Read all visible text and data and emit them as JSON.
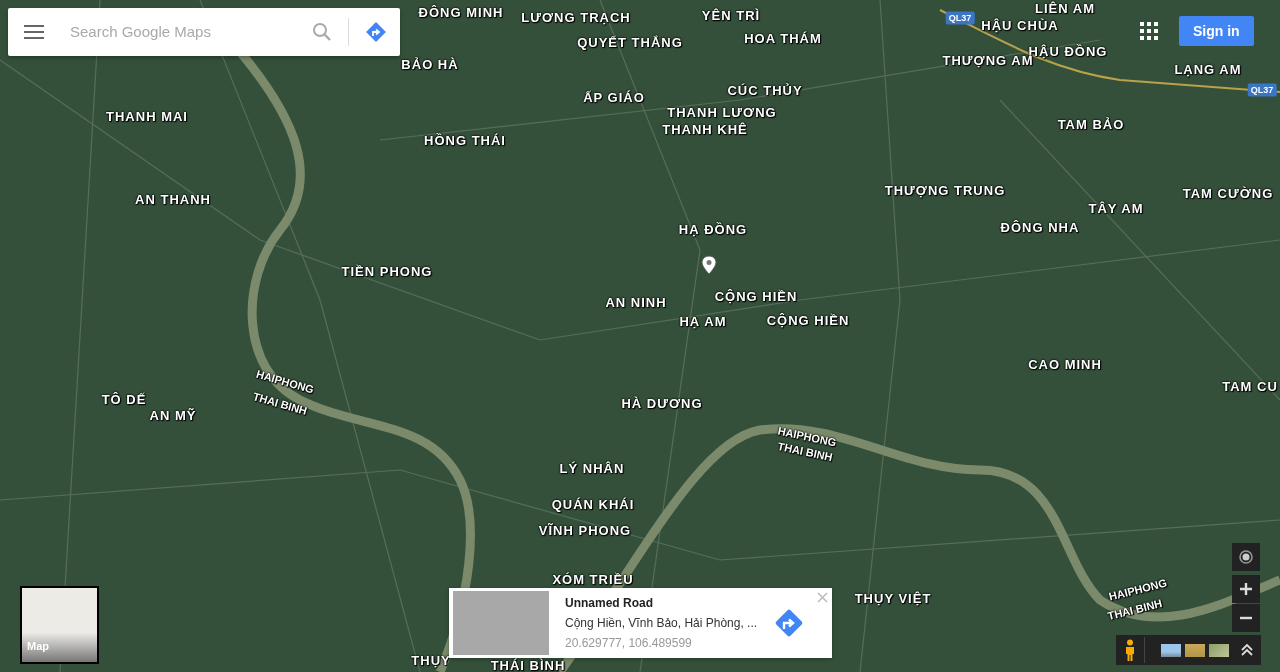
{
  "search": {
    "placeholder": "Search Google Maps"
  },
  "account": {
    "sign_in": "Sign in"
  },
  "map_labels": [
    {
      "text": "ĐÔNG MINH",
      "kind": "place"
    },
    {
      "text": "LƯƠNG TRẠCH",
      "kind": "place"
    },
    {
      "text": "YÊN TRÌ",
      "kind": "place"
    },
    {
      "text": "LIÊN AM",
      "kind": "place"
    },
    {
      "text": "QL37",
      "kind": "road"
    },
    {
      "text": "HẬU CHÙA",
      "kind": "place"
    },
    {
      "text": "QUYẾT THẮNG",
      "kind": "place"
    },
    {
      "text": "HOA THÁM",
      "kind": "place"
    },
    {
      "text": "BẢO HÀ",
      "kind": "place"
    },
    {
      "text": "HẬU ĐỒNG",
      "kind": "place"
    },
    {
      "text": "THƯỢNG AM",
      "kind": "place"
    },
    {
      "text": "LẠNG AM",
      "kind": "place"
    },
    {
      "text": "ẤP GIÁO",
      "kind": "place"
    },
    {
      "text": "CÚC THỦY",
      "kind": "place"
    },
    {
      "text": "QL37",
      "kind": "road"
    },
    {
      "text": "THANH LƯƠNG",
      "kind": "place"
    },
    {
      "text": "THANH MAI",
      "kind": "place"
    },
    {
      "text": "THANH KHÊ",
      "kind": "place"
    },
    {
      "text": "TAM BẢO",
      "kind": "place"
    },
    {
      "text": "HỒNG THÁI",
      "kind": "place"
    },
    {
      "text": "THƯỢNG TRUNG",
      "kind": "place"
    },
    {
      "text": "TAM CƯỜNG",
      "kind": "place"
    },
    {
      "text": "AN THANH",
      "kind": "place"
    },
    {
      "text": "TÂY AM",
      "kind": "place"
    },
    {
      "text": "ĐÔNG NHA",
      "kind": "place"
    },
    {
      "text": "HẠ ĐỒNG",
      "kind": "place"
    },
    {
      "text": "TIỀN PHONG",
      "kind": "place"
    },
    {
      "text": "AN NINH",
      "kind": "place"
    },
    {
      "text": "CỘNG HIỀN",
      "kind": "place"
    },
    {
      "text": "HẠ AM",
      "kind": "place"
    },
    {
      "text": "CỘNG HIỀN",
      "kind": "place"
    },
    {
      "text": "CAO MINH",
      "kind": "place"
    },
    {
      "text": "TAM CU",
      "kind": "place"
    },
    {
      "text": "HAIPHONG",
      "kind": "river"
    },
    {
      "text": "TÔ DẾ",
      "kind": "place"
    },
    {
      "text": "THAI BINH",
      "kind": "river"
    },
    {
      "text": "AN MỸ",
      "kind": "place"
    },
    {
      "text": "HÀ DƯƠNG",
      "kind": "place"
    },
    {
      "text": "HAIPHONG",
      "kind": "river"
    },
    {
      "text": "THAI BINH",
      "kind": "river"
    },
    {
      "text": "LÝ NHÂN",
      "kind": "place"
    },
    {
      "text": "QUÁN KHÁI",
      "kind": "place"
    },
    {
      "text": "VĨNH PHONG",
      "kind": "place"
    },
    {
      "text": "XÓM TRIỀU",
      "kind": "place"
    },
    {
      "text": "THỤY VIỆT",
      "kind": "place"
    },
    {
      "text": "HAIPHONG",
      "kind": "river"
    },
    {
      "text": "THAI BINH",
      "kind": "river"
    },
    {
      "text": "THỤY",
      "kind": "place"
    },
    {
      "text": "THÁI BÌNH",
      "kind": "place"
    }
  ],
  "layer_switcher": {
    "label": "Map"
  },
  "info_card": {
    "title": "Unnamed Road",
    "address": "Cộng Hiền, Vĩnh Bảo, Hải Phòng, ...",
    "coordinates": "20.629777, 106.489599"
  }
}
